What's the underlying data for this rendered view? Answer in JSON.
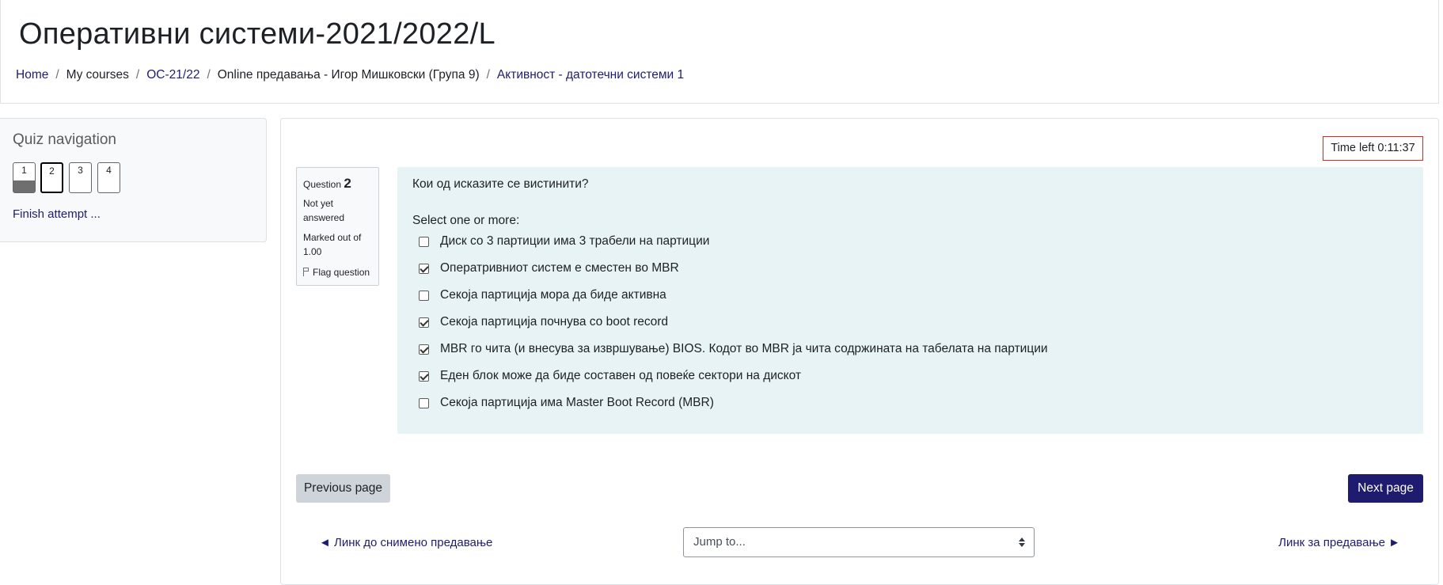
{
  "header": {
    "title": "Оперативни системи-2021/2022/L",
    "breadcrumb": [
      {
        "label": "Home"
      },
      {
        "label": "My courses"
      },
      {
        "label": "ОС-21/22"
      },
      {
        "label": "Online предавања - Игор Мишковски (Група 9)"
      },
      {
        "label": "Активност - датотечни системи 1"
      }
    ],
    "separator": "/"
  },
  "quiz_navigation": {
    "title": "Quiz navigation",
    "buttons": [
      {
        "label": "1",
        "state": "answered"
      },
      {
        "label": "2",
        "state": "current"
      },
      {
        "label": "3",
        "state": "not-answered"
      },
      {
        "label": "4",
        "state": "not-answered"
      }
    ],
    "finish_label": "Finish attempt ..."
  },
  "timer": {
    "label": "Time left 0:11:37"
  },
  "question": {
    "number_prefix": "Question",
    "number": "2",
    "state": "Not yet answered",
    "marked_out_of": "Marked out of 1.00",
    "flag_label": "Flag question",
    "text": "Кои од исказите се вистинити?",
    "prompt": "Select one or more:",
    "answers": [
      {
        "label": "Диск со 3 партиции има 3 трабели на партиции",
        "checked": false
      },
      {
        "label": "Оператривниот систем е сместен во MBR",
        "checked": true
      },
      {
        "label": "Секоја партиција мора да биде активна",
        "checked": false
      },
      {
        "label": "Секоја партиција почнува со boot record",
        "checked": true
      },
      {
        "label": "MBR го чита (и внесува за извршување) BIOS. Кодот во MBR ја чита содржината на табелата на партиции",
        "checked": true
      },
      {
        "label": "Еден блок може да биде составен од повеќе сектори на дискот",
        "checked": true
      },
      {
        "label": "Секоја партиција има Master Boot Record (MBR)",
        "checked": false
      }
    ]
  },
  "navigation": {
    "prev_label": "Previous page",
    "next_label": "Next page",
    "prev_activity": "◄ Линк до снимено предавање",
    "next_activity": "Линк за предавање ►",
    "jump_placeholder": "Jump to..."
  },
  "colors": {
    "primary": "#1f1c70",
    "question_bg": "#e7f3f5",
    "timer_border": "#ca3120",
    "secondary_button": "#ced4da"
  }
}
